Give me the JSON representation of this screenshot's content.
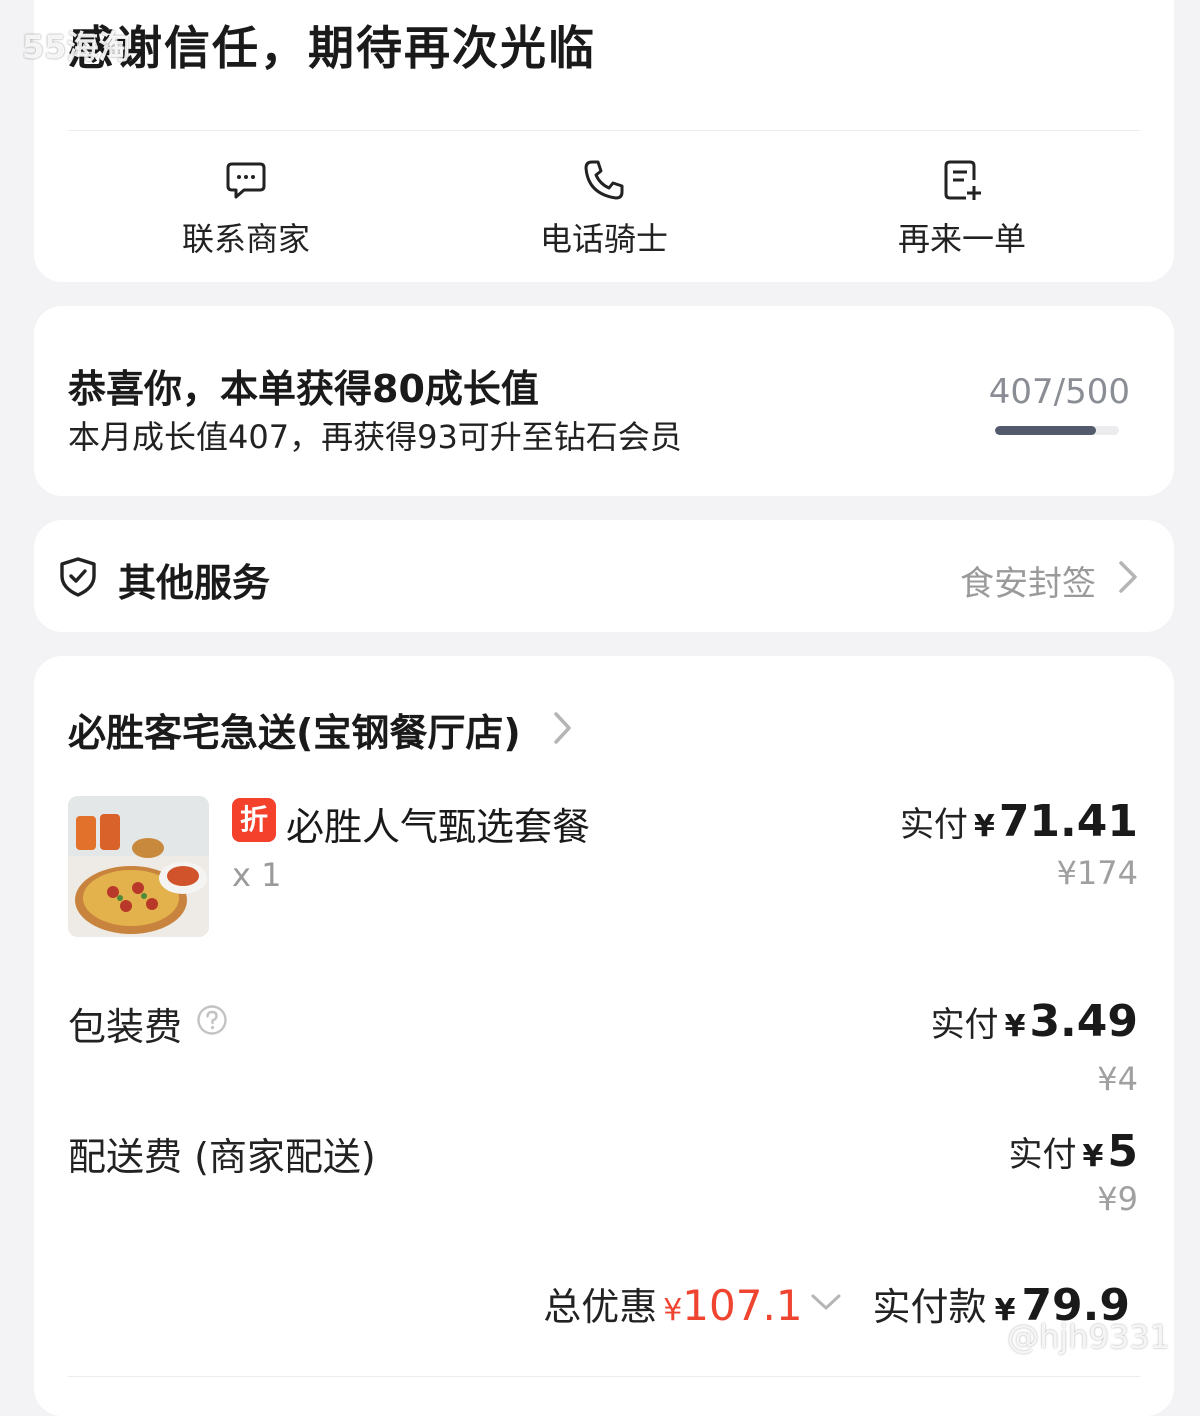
{
  "header": {
    "title": "感谢信任，期待再次光临",
    "actions": [
      {
        "label": "联系商家",
        "icon": "chat-icon"
      },
      {
        "label": "电话骑士",
        "icon": "phone-icon"
      },
      {
        "label": "再来一单",
        "icon": "reorder-icon"
      }
    ]
  },
  "growth": {
    "title": "恭喜你，本单获得80成长值",
    "subtitle": "本月成长值407，再获得93可升至钻石会员",
    "progress_text": "407/500",
    "progress_fraction": 0.814
  },
  "services": {
    "title": "其他服务",
    "right_label": "食安封签"
  },
  "order": {
    "store_name": "必胜客宅急送(宝钢餐厅店)",
    "item": {
      "badge": "折",
      "name": "必胜人气甄选套餐",
      "qty": "x 1",
      "paid_label": "实付",
      "currency": "¥",
      "paid_amount": "71.41",
      "original_price": "¥174"
    },
    "packaging": {
      "label": "包装费",
      "paid_label": "实付",
      "currency": "¥",
      "paid_amount": "3.49",
      "original_price": "¥4"
    },
    "delivery": {
      "label": "配送费 (商家配送)",
      "paid_label": "实付",
      "currency": "¥",
      "paid_amount": "5",
      "original_price": "¥9"
    },
    "summary": {
      "discount_label": "总优惠",
      "discount_currency": "¥",
      "discount_amount": "107.1",
      "paid_label": "实付款",
      "paid_currency": "¥",
      "paid_amount": "79.9"
    }
  },
  "watermarks": {
    "top_left": "55海淘",
    "bottom_right": "@hjh9331"
  },
  "colors": {
    "accent_red": "#ef4530",
    "badge_red": "#f4412c",
    "progress": "#545a6e",
    "background": "#f3f3f5"
  }
}
